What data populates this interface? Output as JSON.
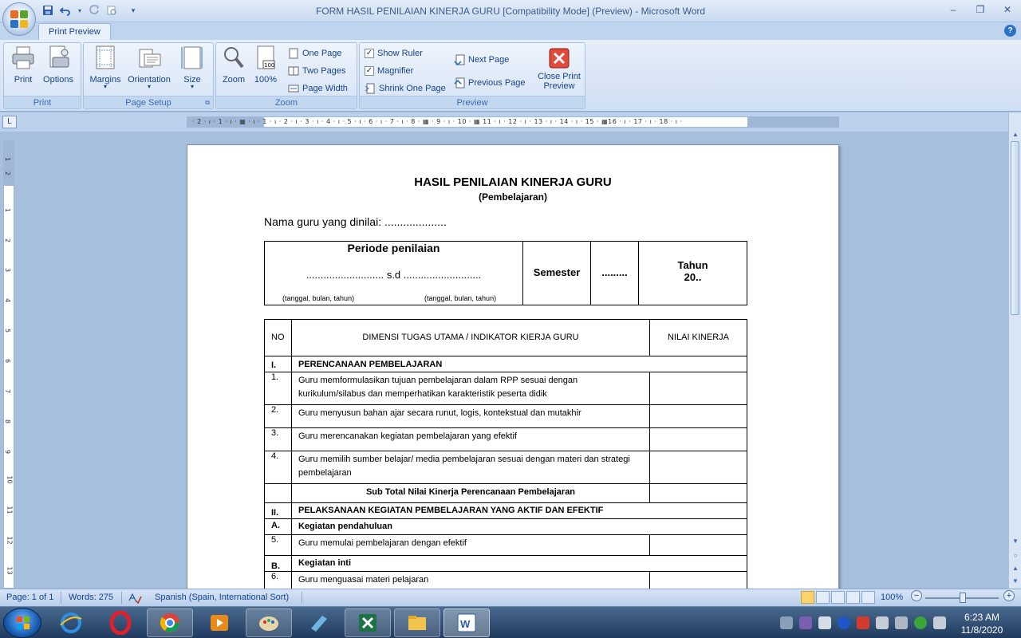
{
  "window": {
    "title": "FORM HASIL PENILAIAN KINERJA GURU [Compatibility Mode] (Preview) - Microsoft Word",
    "minimize": "–",
    "restore": "❐",
    "close": "✕"
  },
  "ribbon": {
    "active_tab": "Print Preview",
    "help": "?",
    "groups": {
      "print": {
        "label": "Print",
        "print_label": "Print",
        "options_label": "Options"
      },
      "page_setup": {
        "label": "Page Setup",
        "margins_label": "Margins",
        "orientation_label": "Orientation",
        "size_label": "Size"
      },
      "zoom": {
        "label": "Zoom",
        "zoom_label": "Zoom",
        "hundred_label": "100%",
        "one_page_label": "One Page",
        "two_pages_label": "Two Pages",
        "page_width_label": "Page Width"
      },
      "preview": {
        "label": "Preview",
        "show_ruler_label": "Show Ruler",
        "show_ruler_checked": true,
        "magnifier_label": "Magnifier",
        "magnifier_checked": true,
        "shrink_label": "Shrink One Page",
        "next_page_label": "Next Page",
        "previous_page_label": "Previous Page",
        "close_label_1": "Close Print",
        "close_label_2": "Preview"
      }
    }
  },
  "ruler": {
    "tab_selector": "L",
    "h_numbers": "· 2 · ı · 1 · ı · ▦ · ı · 1 · ı · 2 · ı · 3 · ı · 4 · ı · 5 · ı · 6 · ı · 7 · ı · 8 · ▦ · 9 · ı · 10 · ▦ 11 · ı · 12 · ı · 13 · ı · 14 · ı · 15 · ▦16 · ı · 17 · ı · 18 · ı ·",
    "v_numbers": [
      "1",
      "2",
      "1",
      "1",
      "2",
      "3",
      "4",
      "5",
      "6",
      "7",
      "8",
      "9",
      "10",
      "11",
      "12",
      "13"
    ]
  },
  "document": {
    "title": "HASIL PENILAIAN KINERJA GURU",
    "subtitle": "(Pembelajaran)",
    "nama_label": "Nama guru yang dinilai: ....................",
    "periode_header": "Periode penilaian",
    "periode_dots": "........................... s.d ...........................",
    "hint_from": "(tanggal, bulan, tahun)",
    "hint_to": "(tanggal, bulan, tahun)",
    "semester_label": "Semester",
    "semester_value": ".........",
    "tahun_label": "Tahun",
    "tahun_value": "20..",
    "table_headers": {
      "no": "NO",
      "dimensi": "DIMENSI TUGAS UTAMA / INDIKATOR KIERJA GURU",
      "nilai": "NILAI KINERJA"
    },
    "rows": [
      {
        "no": "I.",
        "text": "PERENCANAAN PEMBELAJARAN"
      },
      {
        "no": "1.",
        "text": "Guru memformulasikan tujuan pembelajaran dalam RPP sesuai dengan kurikulum/silabus dan memperhatikan karakteristik peserta didik"
      },
      {
        "no": "2.",
        "text": "Guru menyusun bahan ajar secara runut, logis, kontekstual dan mutakhir"
      },
      {
        "no": "3.",
        "text": "Guru merencanakan kegiatan pembelajaran yang efektif"
      },
      {
        "no": "4.",
        "text": "Guru memilih sumber belajar/ media pembelajaran sesuai dengan materi dan strategi pembelajaran"
      },
      {
        "no": "",
        "text": "Sub Total Nilai Kinerja Perencanaan Pembelajaran"
      },
      {
        "no": "II.",
        "text": "PELAKSANAAN KEGIATAN PEMBELAJARAN YANG AKTIF DAN EFEKTIF"
      },
      {
        "no": "A.",
        "text": "Kegiatan pendahuluan"
      },
      {
        "no": "5.",
        "text": "Guru memulai pembelajaran dengan efektif"
      },
      {
        "no": "B.",
        "text": "Kegiatan inti"
      },
      {
        "no": "6.",
        "text": "Guru menguasai materi pelajaran"
      }
    ]
  },
  "statusbar": {
    "page": "Page: 1 of 1",
    "words": "Words: 275",
    "language": "Spanish (Spain, International Sort)",
    "zoom": "100%",
    "zoom_minus": "−",
    "zoom_plus": "+"
  },
  "taskbar": {
    "time": "6:23 AM",
    "date": "11/8/2020"
  },
  "colors": {
    "ribbon_blue": "#15428b",
    "doc_bg": "#a5bfdc",
    "taskbar": "#1f3a5e"
  }
}
